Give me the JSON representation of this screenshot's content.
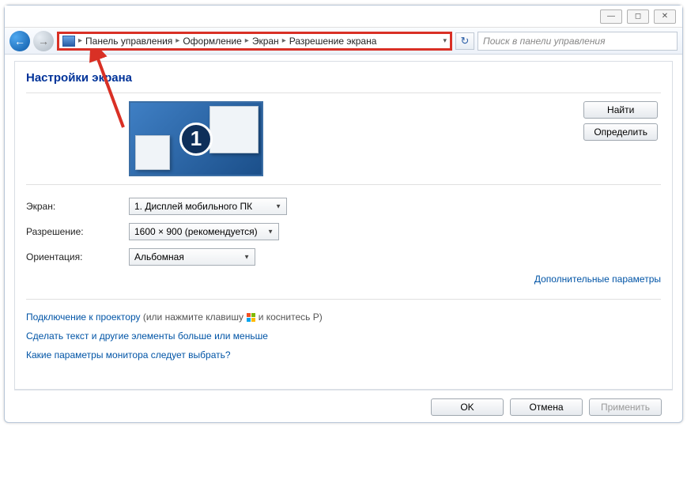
{
  "window_controls": {
    "min": "—",
    "max": "◻",
    "close": "✕"
  },
  "breadcrumb": {
    "items": [
      "Панель управления",
      "Оформление",
      "Экран",
      "Разрешение экрана"
    ]
  },
  "search": {
    "placeholder": "Поиск в панели управления"
  },
  "heading": "Настройки экрана",
  "display_badge": "1",
  "side_buttons": {
    "find": "Найти",
    "identify": "Определить"
  },
  "form": {
    "screen_label": "Экран:",
    "screen_value": "1. Дисплей мобильного ПК",
    "resolution_label": "Разрешение:",
    "resolution_value": "1600 × 900 (рекомендуется)",
    "orientation_label": "Ориентация:",
    "orientation_value": "Альбомная"
  },
  "advanced_link": "Дополнительные параметры",
  "links": {
    "projector_a": "Подключение к проектору",
    "projector_hint_pre": " (или нажмите клавишу ",
    "projector_hint_post": " и коснитесь P)",
    "text_size": "Сделать текст и другие элементы больше или меньше",
    "which_params": "Какие параметры монитора следует выбрать?"
  },
  "buttons": {
    "ok": "OK",
    "cancel": "Отмена",
    "apply": "Применить"
  }
}
